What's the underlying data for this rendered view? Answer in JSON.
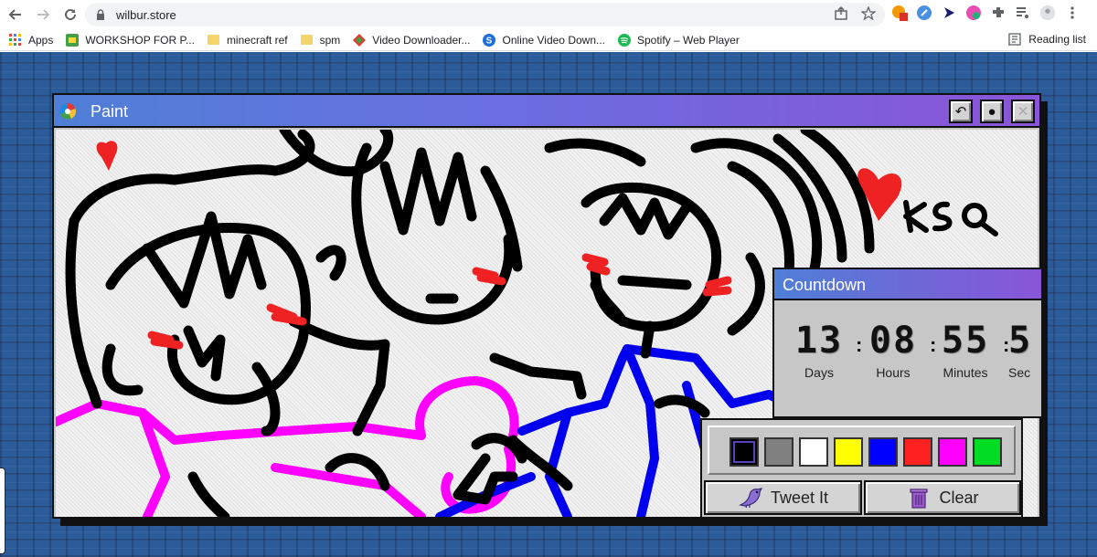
{
  "browser": {
    "url": "wilbur.store",
    "bookmarks": [
      {
        "label": "Apps",
        "icon": "apps-grid-icon"
      },
      {
        "label": "WORKSHOP FOR P...",
        "icon": "workshop-icon"
      },
      {
        "label": "minecraft ref",
        "icon": "folder-icon"
      },
      {
        "label": "spm",
        "icon": "folder-icon"
      },
      {
        "label": "Video Downloader...",
        "icon": "video-downloader-icon"
      },
      {
        "label": "Online Video Down...",
        "icon": "s-logo-icon"
      },
      {
        "label": "Spotify – Web Player",
        "icon": "spotify-icon"
      }
    ],
    "reading_list": "Reading list"
  },
  "paint_window": {
    "title": "Paint",
    "buttons": {
      "undo": "↶",
      "record": "●",
      "close": "✕"
    }
  },
  "countdown": {
    "title": "Countdown",
    "units": [
      {
        "value": "13",
        "label": "Days"
      },
      {
        "value": "08",
        "label": "Hours"
      },
      {
        "value": "55",
        "label": "Minutes"
      },
      {
        "value": "5",
        "label": "Sec"
      }
    ]
  },
  "palette": {
    "colors": [
      "#000000",
      "#808080",
      "#ffffff",
      "#ffff00",
      "#0000ff",
      "#ff2020",
      "#ff00ff",
      "#00dd22"
    ],
    "selected_index": 0,
    "tweet_label": "Tweet It",
    "clear_label": "Clear"
  },
  "canvas": {
    "signature": "KSQ"
  }
}
